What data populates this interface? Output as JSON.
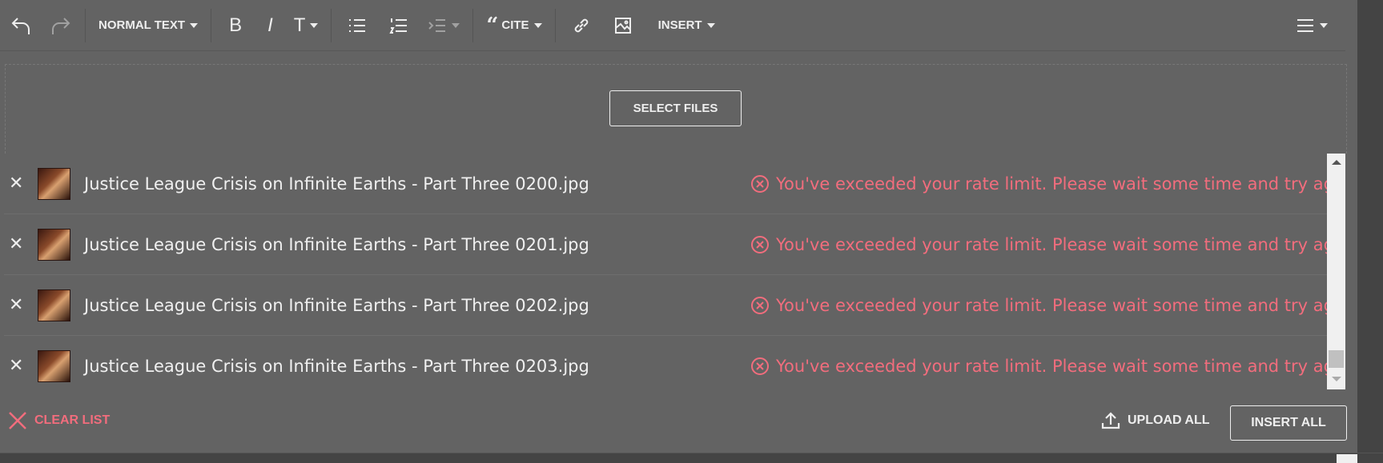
{
  "toolbar": {
    "undo": "undo-icon",
    "redo": "redo-icon",
    "text_style": "NORMAL TEXT",
    "bold": "B",
    "italic": "I",
    "text_size": "T",
    "cite": "CITE",
    "insert": "INSERT"
  },
  "upload": {
    "select_files": "SELECT FILES",
    "files": [
      {
        "name": "Justice League Crisis on Infinite Earths - Part Three 0200.jpg",
        "error": "You've exceeded your rate limit. Please wait some time and try again."
      },
      {
        "name": "Justice League Crisis on Infinite Earths - Part Three 0201.jpg",
        "error": "You've exceeded your rate limit. Please wait some time and try again."
      },
      {
        "name": "Justice League Crisis on Infinite Earths - Part Three 0202.jpg",
        "error": "You've exceeded your rate limit. Please wait some time and try again."
      },
      {
        "name": "Justice League Crisis on Infinite Earths - Part Three 0203.jpg",
        "error": "You've exceeded your rate limit. Please wait some time and try again."
      }
    ],
    "clear_list": "CLEAR LIST",
    "upload_all": "UPLOAD ALL",
    "insert_all": "INSERT ALL"
  },
  "colors": {
    "background": "#636363",
    "error": "#f26d7d",
    "text": "#eeeeee"
  }
}
